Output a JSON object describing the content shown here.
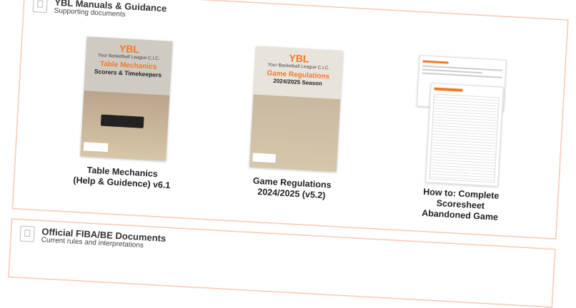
{
  "section1": {
    "title": "YBL Manuals & Guidance",
    "subtitle": "Supporting documents"
  },
  "section2": {
    "title": "Official FIBA/BE Documents",
    "subtitle": "Current rules and interpretations"
  },
  "docs": [
    {
      "caption_line1": "Table Mechanics",
      "caption_line2": "(Help & Guidence) v6.1",
      "logo": "YBL",
      "org": "Your Basketball League C.I.C.",
      "heading1": "Table Mechanics",
      "heading2": "Scorers & Timekeepers"
    },
    {
      "caption_line1": "Game Regulations",
      "caption_line2": "2024/2025 (v5.2)",
      "logo": "YBL",
      "org": "Your Basketball League C.I.C.",
      "heading1": "Game Regulations",
      "heading2": "2024/2025 Season"
    },
    {
      "caption_line1": "How to: Complete Scoresheet",
      "caption_line2": "Abandoned Game"
    }
  ],
  "colors": {
    "accent": "#f07a2a",
    "border": "#f2c3a7"
  }
}
